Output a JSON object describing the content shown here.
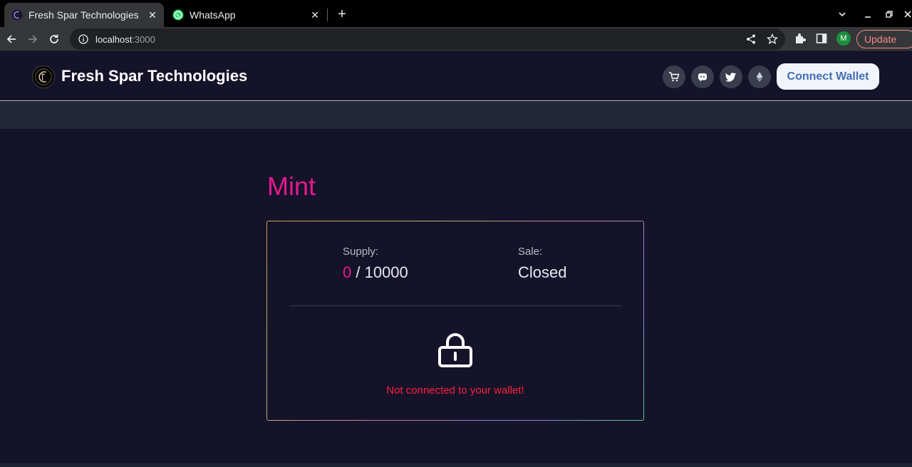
{
  "browser": {
    "tabs": [
      {
        "title": "Fresh Spar Technologies",
        "active": true,
        "favicon": "site-logo-icon"
      },
      {
        "title": "WhatsApp",
        "active": false,
        "favicon": "whatsapp-icon"
      }
    ],
    "address": {
      "host": "localhost",
      "port": ":3000"
    },
    "update_label": "Update",
    "profile_initial": "M"
  },
  "header": {
    "brand": "Fresh Spar Technologies",
    "icons": [
      "cart-icon",
      "discord-icon",
      "twitter-icon",
      "ethereum-icon"
    ],
    "connect_label": "Connect Wallet"
  },
  "mint": {
    "title": "Mint",
    "supply_label": "Supply:",
    "supply_minted": "0",
    "supply_separator": "/ 10000",
    "sale_label": "Sale:",
    "sale_status": "Closed",
    "status_message": "Not connected to your wallet!"
  },
  "colors": {
    "accent": "#e6198c",
    "error": "#ff1f3d",
    "background": "#14132a",
    "button_text": "#3f6fb0"
  }
}
